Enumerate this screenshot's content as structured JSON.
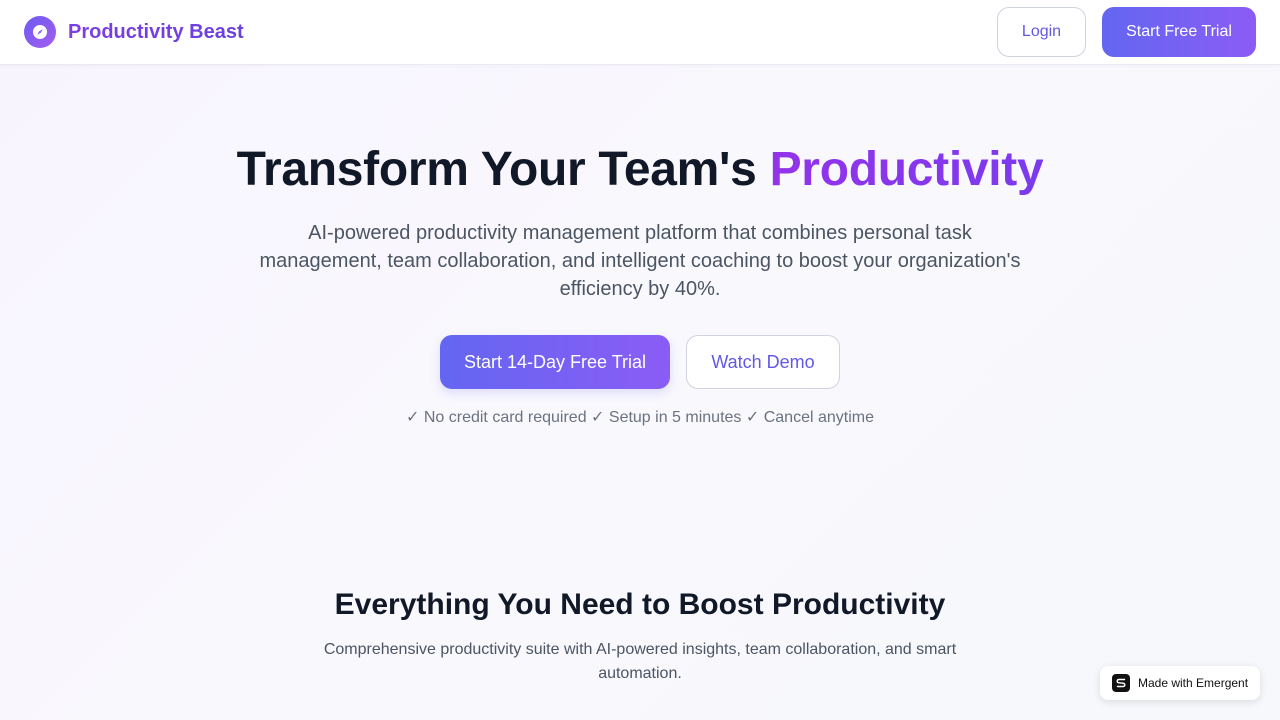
{
  "header": {
    "brand_name": "Productivity Beast",
    "login_label": "Login",
    "trial_label": "Start Free Trial"
  },
  "hero": {
    "title_prefix": "Transform Your Team's ",
    "title_accent": "Productivity",
    "subtitle": "AI-powered productivity management platform that combines personal task management, team collaboration, and intelligent coaching to boost your organization's efficiency by 40%.",
    "primary_cta": "Start 14-Day Free Trial",
    "secondary_cta": "Watch Demo",
    "note": "✓ No credit card required ✓ Setup in 5 minutes ✓ Cancel anytime"
  },
  "features": {
    "title": "Everything You Need to Boost Productivity",
    "subtitle": "Comprehensive productivity suite with AI-powered insights, team collaboration, and smart automation."
  },
  "badge": {
    "label": "Made with Emergent",
    "icon": "emergent-logo-icon"
  },
  "colors": {
    "brand_gradient_start": "#6366f1",
    "brand_gradient_end": "#8b5cf6",
    "accent_purple": "#8b3fe8",
    "heading": "#111827",
    "body_text": "#4b5563",
    "muted_text": "#6b7280"
  },
  "icons": {
    "logo": "compass-logo-icon"
  }
}
